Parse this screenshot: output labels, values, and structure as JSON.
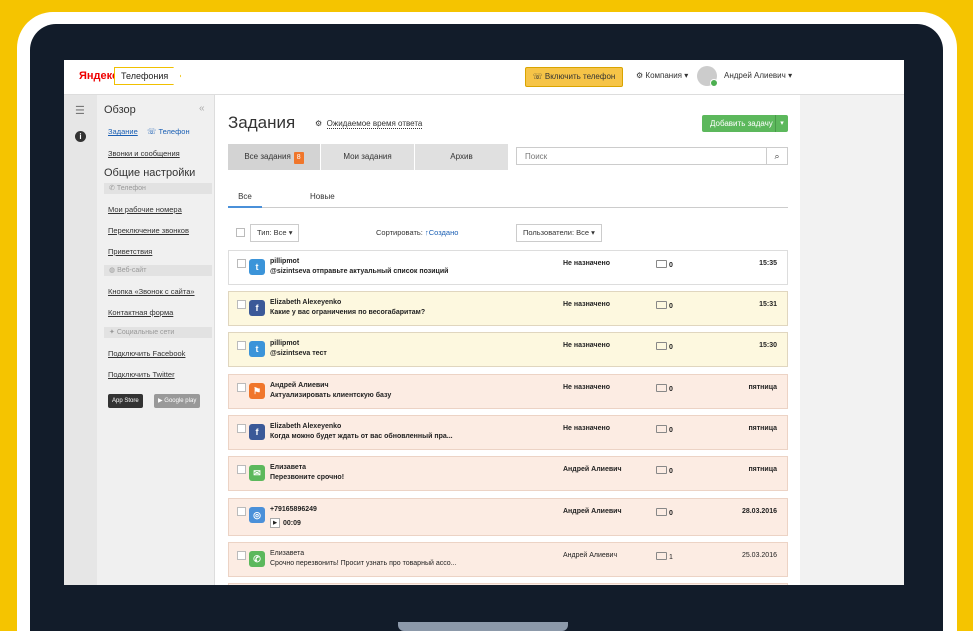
{
  "header": {
    "logo": "Яндекс",
    "product": "Телефония",
    "phone_button": "Включить телефон",
    "company": "Компания",
    "user": "Андрей Алиевич"
  },
  "sidebar": {
    "title": "Обзор",
    "tasks_link": "Задание",
    "phone_link": "Телефон",
    "calls_link": "Звонки и сообщения",
    "general_title": "Общие настройки",
    "group_phone": "Телефон",
    "my_numbers": "Мои рабочие номера",
    "call_switch": "Переключение звонков",
    "greetings": "Приветствия",
    "group_site": "Веб-сайт",
    "call_button": "Кнопка «Звонок с сайта»",
    "contact_form": "Контактная форма",
    "group_social": "Социальные сети",
    "connect_facebook": "Подключить Facebook",
    "connect_twitter": "Подключить Twitter",
    "app_store": "App Store",
    "google_play": "Google play"
  },
  "main": {
    "title": "Задания",
    "response_time": "Ожидаемое время ответа",
    "add_task": "Добавить задачу",
    "tabs": {
      "all": "Все задания",
      "all_count": "8",
      "mine": "Мои задания",
      "archive": "Архив"
    },
    "search_placeholder": "Поиск",
    "subtabs": {
      "all": "Все",
      "new": "Новые"
    },
    "filters": {
      "type": "Тип: Все",
      "sort_label": "Сортировать:",
      "sort_value": "Создано",
      "users": "Пользователи: Все"
    }
  },
  "tasks": [
    {
      "author": "pillipmot",
      "text": "@sizintseva отправьте актуальный список позиций",
      "assignee": "Не назначено",
      "count": "0",
      "time": "15:35",
      "icon": "twitter-icon"
    },
    {
      "author": "Elizabeth Alexeyenko",
      "text": "Какие у вас ограничения по весогабаритам?",
      "assignee": "Не назначено",
      "count": "0",
      "time": "15:31",
      "icon": "facebook-icon"
    },
    {
      "author": "pillipmot",
      "text": "@sizintseva тест",
      "assignee": "Не назначено",
      "count": "0",
      "time": "15:30",
      "icon": "twitter-icon"
    },
    {
      "author": "Андрей Алиевич",
      "text": "Актуализировать клиентскую базу",
      "assignee": "Не назначено",
      "count": "0",
      "time": "пятница",
      "icon": "flag-icon"
    },
    {
      "author": "Elizabeth Alexeyenko",
      "text": "Когда можно будет ждать от вас обновленный пра...",
      "assignee": "Не назначено",
      "count": "0",
      "time": "пятница",
      "icon": "facebook-icon"
    },
    {
      "author": "Елизавета",
      "text": "Перезвоните срочно!",
      "assignee": "Андрей Алиевич",
      "count": "0",
      "time": "пятница",
      "icon": "message-icon"
    },
    {
      "author": "+79165896249",
      "text": "00:09",
      "assignee": "Андрей Алиевич",
      "count": "0",
      "time": "28.03.2016",
      "icon": "voicemail-icon"
    },
    {
      "author": "Елизавета",
      "text": "Срочно перезвонить! Просит узнать про товарный ассо...",
      "assignee": "Андрей Алиевич",
      "count": "1",
      "time": "25.03.2016",
      "icon": "phone-icon"
    }
  ],
  "colors": {
    "background": "#f5c400",
    "bezel": "#121c2a",
    "accent_green": "#5cb85c",
    "badge_orange": "#f0762b",
    "twitter": "#3b94d9",
    "facebook": "#3b5998"
  }
}
